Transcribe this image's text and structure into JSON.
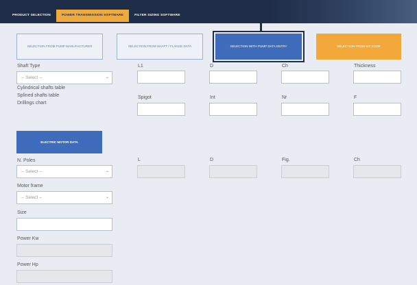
{
  "tabs": [
    {
      "label": "Product Selection"
    },
    {
      "label": "Power Transmission Software"
    },
    {
      "label": "Filter Sizing Software"
    }
  ],
  "selection_buttons": [
    {
      "label": "Selection from pump manufacturer"
    },
    {
      "label": "Selection from shaft / flange data"
    },
    {
      "label": "Selection with pump data entry"
    },
    {
      "label": "Selection from kit code"
    }
  ],
  "shaft": {
    "type_label": "Shaft Type",
    "select_placeholder": "-- Select --",
    "links": [
      "Cylindrical shafts table",
      "Splined shafts table",
      "Drillings chart"
    ]
  },
  "fields_row1": [
    "L1",
    "D",
    "Ch",
    "Thickness"
  ],
  "fields_row2": [
    "Spigot",
    "Int",
    "Nr",
    "F"
  ],
  "motor": {
    "button_label": "Electric motor data",
    "poles_label": "N. Poles",
    "poles_placeholder": "-- Select --",
    "frame_label": "Motor frame",
    "frame_placeholder": "-- Select --",
    "size_label": "Size",
    "power_kw_label": "Power Kw",
    "power_hp_label": "Power Hp"
  },
  "motor_fields": [
    "L",
    "D",
    "Fig.",
    "Ch"
  ]
}
